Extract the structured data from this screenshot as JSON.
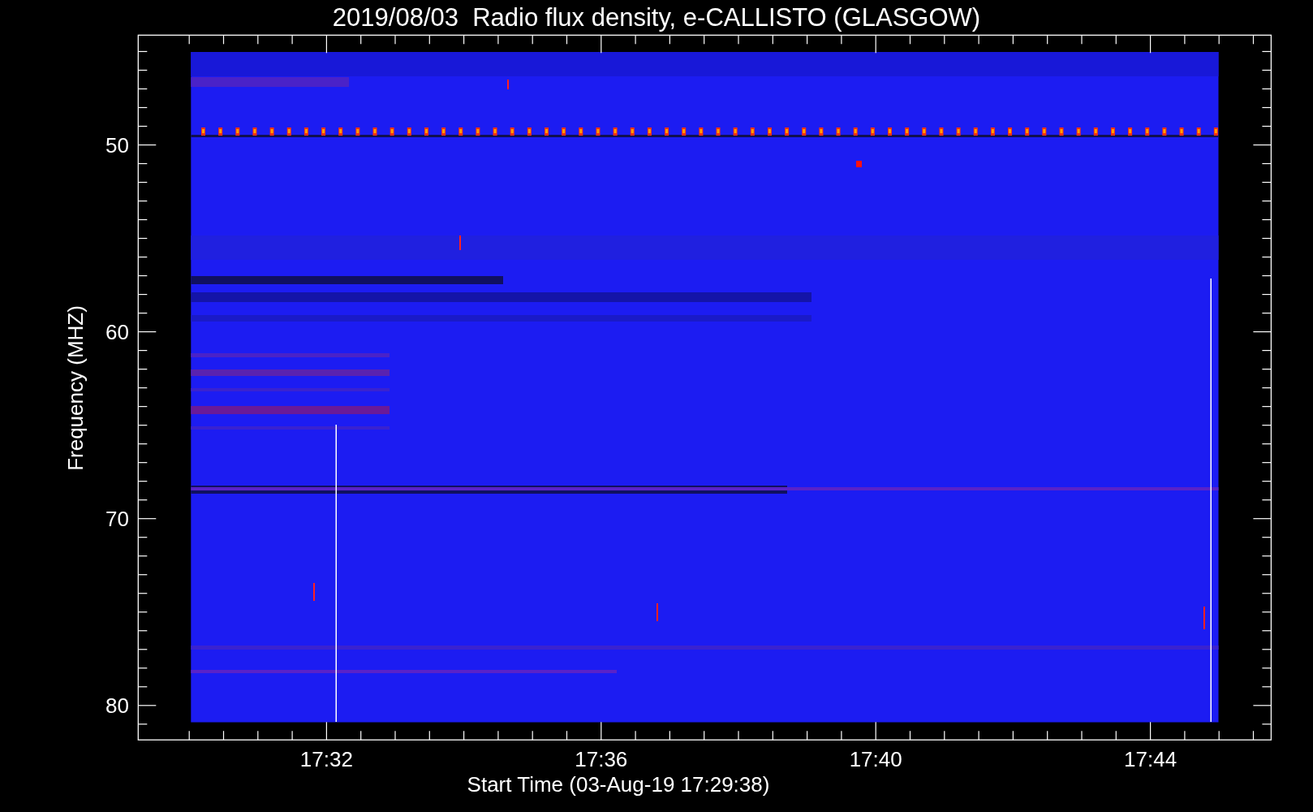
{
  "title": "2019/08/03  Radio flux density, e-CALLISTO (GLASGOW)",
  "y_axis": {
    "label": "Frequency (MHZ)",
    "ticks": [
      "50",
      "60",
      "70",
      "80"
    ]
  },
  "x_axis": {
    "label": "Start Time (03-Aug-19 17:29:38)",
    "ticks": [
      "17:32",
      "17:36",
      "17:40",
      "17:44"
    ]
  }
}
